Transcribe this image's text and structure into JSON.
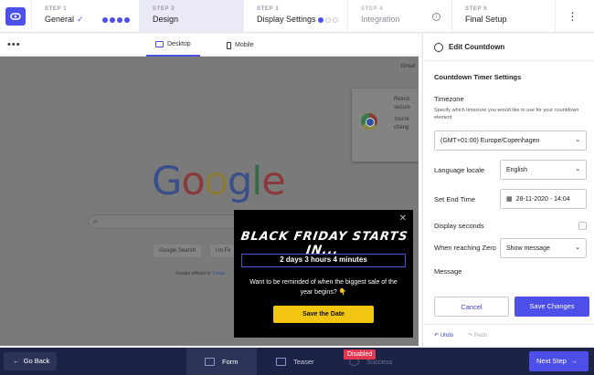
{
  "steps": [
    {
      "num": "STEP 1",
      "name": "General"
    },
    {
      "num": "STEP 2",
      "name": "Design"
    },
    {
      "num": "STEP 3",
      "name": "Display Settings"
    },
    {
      "num": "STEP 4",
      "name": "Integration"
    },
    {
      "num": "STEP 5",
      "name": "Final Setup"
    }
  ],
  "preview": {
    "desktop_label": "Desktop",
    "mobile_label": "Mobile",
    "site": {
      "gmail": "Gmail",
      "logo": "Google",
      "search_btn": "Google Search",
      "lucky_btn": "I'm Fe",
      "offered": "Google offered in:",
      "offered_link": "Deuts",
      "card_text1": "Reinst",
      "card_text2": "secure",
      "card_text3": "You're",
      "card_text4": "chang"
    },
    "popup": {
      "title": "BLACK FRIDAY STARTS IN...",
      "countdown": "2 days 3 hours 4 minutes",
      "message": "Want to be reminded of when the biggest sale of the year begins? 👇",
      "button": "Save the Date"
    }
  },
  "panel": {
    "title": "Edit Countdown",
    "section": "Countdown Timer Settings",
    "timezone_label": "Timezone",
    "timezone_hint": "Specify which timezone you would like to use for your countdown element",
    "timezone_value": "(GMT+01:00) Europe/Copenhagen",
    "locale_label": "Language locale",
    "locale_value": "English",
    "end_label": "Set End Time",
    "end_value": "28-11-2020 - 14:04",
    "seconds_label": "Display seconds",
    "zero_label": "When reaching Zero",
    "zero_value": "Show message",
    "message_label": "Message",
    "cancel": "Cancel",
    "save": "Save Changes",
    "undo": "Undo",
    "redo": "Redo"
  },
  "bottom": {
    "back": "Go Back",
    "form": "Form",
    "teaser": "Teaser",
    "success": "Success",
    "disabled_badge": "Disabled",
    "next": "Next Step"
  },
  "colors": {
    "accent": "#4c4fe8",
    "navy": "#1d2346",
    "danger": "#e3374f",
    "popup_btn": "#f2c511"
  }
}
